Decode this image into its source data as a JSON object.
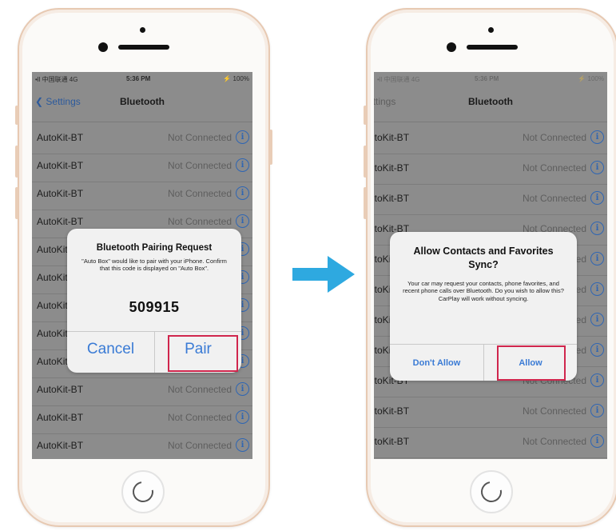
{
  "colors": {
    "accent": "#3a7bd5",
    "highlight": "#d0264d",
    "arrow": "#2ea9e0",
    "dim_screen": "#8c8c8c"
  },
  "icons": {
    "arrow": "right-arrow-icon",
    "info": "info-icon",
    "back": "chevron-left-icon"
  },
  "left_phone": {
    "status_bar": {
      "carrier": "•ll 中国联通 4G",
      "time": "5:36 PM",
      "battery": "⚡ 100%"
    },
    "nav": {
      "back_label": "Settings",
      "title": "Bluetooth"
    },
    "devices": [
      {
        "name": "AutoKit-BT",
        "status": "Not Connected"
      },
      {
        "name": "AutoKit-BT",
        "status": "Not Connected"
      },
      {
        "name": "AutoKit-BT",
        "status": "Not Connected"
      },
      {
        "name": "AutoKit-BT",
        "status": "Not Connected"
      },
      {
        "name": "AutoKit-BT",
        "status": "Not Connected"
      },
      {
        "name": "AutoKit-BT",
        "status": "Not Connected"
      },
      {
        "name": "AutoKit-BT",
        "status": "Not Connected"
      },
      {
        "name": "AutoKit-BT",
        "status": "Not Connected"
      },
      {
        "name": "AutoKit-BT",
        "status": "Not Connected"
      },
      {
        "name": "AutoKit-BT",
        "status": "Not Connected"
      },
      {
        "name": "AutoKit-BT",
        "status": "Not Connected"
      },
      {
        "name": "AutoKit-BT",
        "status": "Not Connected"
      }
    ],
    "dialog": {
      "title": "Bluetooth Pairing Request",
      "message": "\"Auto Box\" would like to pair with your iPhone. Confirm that this code is displayed on \"Auto Box\".",
      "code": "509915",
      "cancel_label": "Cancel",
      "pair_label": "Pair"
    }
  },
  "right_phone": {
    "status_bar": {
      "carrier": "•ll 中国联通 4G",
      "time": "5:36 PM",
      "battery": "⚡ 100%"
    },
    "nav": {
      "back_label": "Settings",
      "title": "Bluetooth"
    },
    "devices": [
      {
        "name": "AutoKit-BT",
        "status": "Not Connected"
      },
      {
        "name": "AutoKit-BT",
        "status": "Not Connected"
      },
      {
        "name": "AutoKit-BT",
        "status": "Not Connected"
      },
      {
        "name": "AutoKit-BT",
        "status": "Not Connected"
      },
      {
        "name": "AutoKit-BT",
        "status": "Not Connected"
      },
      {
        "name": "AutoKit-BT",
        "status": "Not Connected"
      },
      {
        "name": "AutoKit-BT",
        "status": "Not Connected"
      },
      {
        "name": "AutoKit-BT",
        "status": "Not Connected"
      },
      {
        "name": "AutoKit-BT",
        "status": "Not Connected"
      },
      {
        "name": "AutoKit-BT",
        "status": "Not Connected"
      },
      {
        "name": "AutoKit-BT",
        "status": "Not Connected"
      }
    ],
    "dialog": {
      "title": "Allow Contacts and Favorites Sync?",
      "message": "Your car may request your contacts, phone favorites, and recent phone calls over Bluetooth. Do you wish to allow this? CarPlay will work without syncing.",
      "dont_allow_label": "Don't Allow",
      "allow_label": "Allow"
    }
  }
}
